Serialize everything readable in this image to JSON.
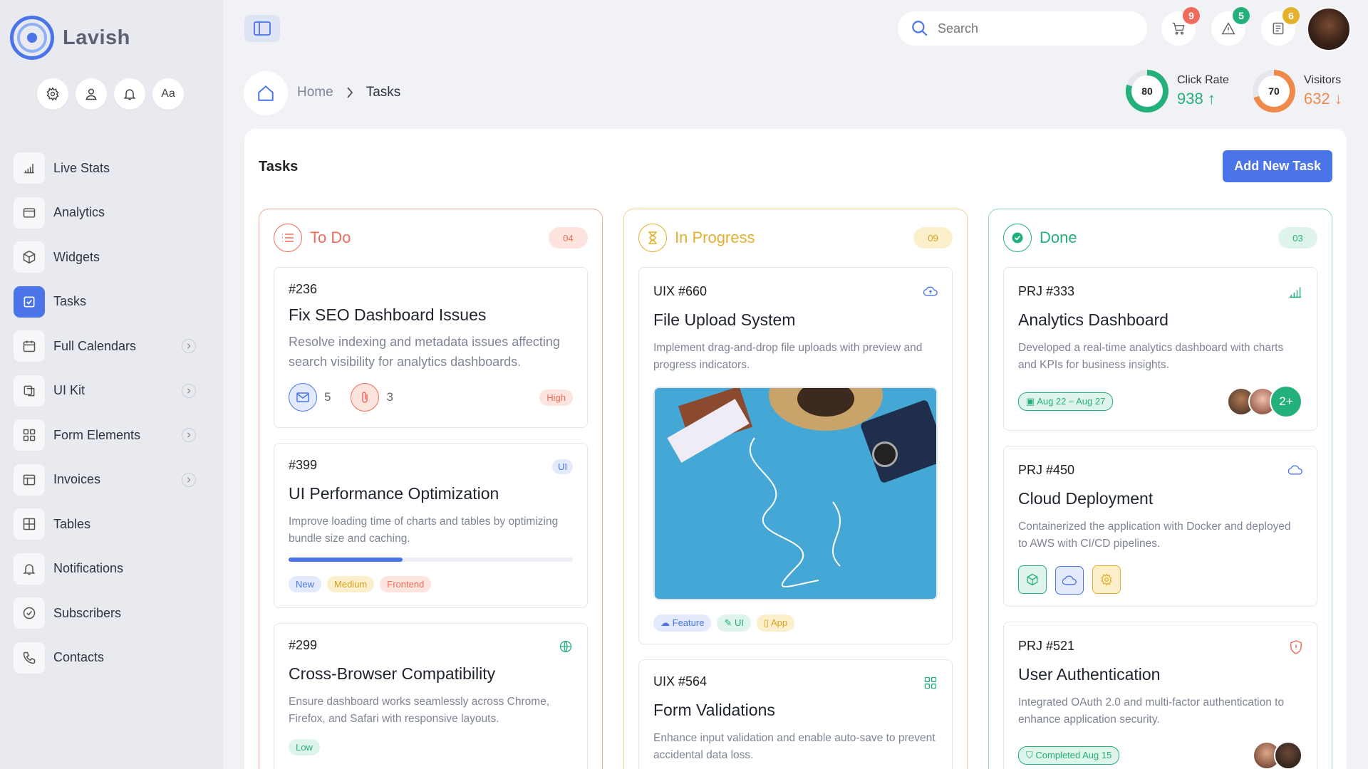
{
  "brand": {
    "name": "Lavish",
    "accent": "#4a74e8"
  },
  "quick_actions": [
    {
      "icon": "gear-icon"
    },
    {
      "icon": "user-icon"
    },
    {
      "icon": "bell-icon"
    },
    {
      "label": "Aa"
    }
  ],
  "nav": [
    {
      "label": "Live Stats",
      "icon": "bar-chart-icon"
    },
    {
      "label": "Analytics",
      "icon": "window-icon"
    },
    {
      "label": "Widgets",
      "icon": "cube-icon"
    },
    {
      "label": "Tasks",
      "icon": "checkbox-icon",
      "active": true
    },
    {
      "label": "Full Calendars",
      "icon": "calendar-icon",
      "has_chevron": true
    },
    {
      "label": "UI Kit",
      "icon": "layers-icon",
      "has_chevron": true
    },
    {
      "label": "Form Elements",
      "icon": "grid-icon",
      "has_chevron": true
    },
    {
      "label": "Invoices",
      "icon": "invoice-icon",
      "has_chevron": true
    },
    {
      "label": "Tables",
      "icon": "table-icon"
    },
    {
      "label": "Notifications",
      "icon": "bell-icon"
    },
    {
      "label": "Subscribers",
      "icon": "check-circle-icon"
    },
    {
      "label": "Contacts",
      "icon": "phone-icon"
    }
  ],
  "search": {
    "placeholder": "Search"
  },
  "top_badges": {
    "cart": "9",
    "alerts": "5",
    "notes": "6"
  },
  "breadcrumb": {
    "home": "Home",
    "current": "Tasks"
  },
  "stats": {
    "click_rate": {
      "label": "Click Rate",
      "value": "938 ↑",
      "ring": "80",
      "percent": 80,
      "color": "#23b07a"
    },
    "visitors": {
      "label": "Visitors",
      "value": "632 ↓",
      "ring": "70",
      "percent": 70,
      "color": "#f08a4b"
    }
  },
  "panel": {
    "title": "Tasks",
    "add_button": "Add New Task"
  },
  "columns": {
    "todo": {
      "title": "To Do",
      "count": "04",
      "color": "#f06b5a"
    },
    "progress": {
      "title": "In Progress",
      "count": "09",
      "color": "#e5b02c"
    },
    "done": {
      "title": "Done",
      "count": "03",
      "color": "#23b07a"
    }
  },
  "todo_cards": [
    {
      "id": "#236",
      "title": "Fix SEO Dashboard Issues",
      "desc": "Resolve indexing and metadata issues affecting search visibility for analytics dashboards.",
      "mail_count": "5",
      "attach_count": "3",
      "priority": "High"
    },
    {
      "id": "#399",
      "title": "UI Performance Optimization",
      "desc": "Improve loading time of charts and tables by optimizing bundle size and caching.",
      "badge": "UI",
      "progress": 0.4,
      "tags": [
        "New",
        "Medium",
        "Frontend"
      ]
    },
    {
      "id": "#299",
      "title": "Cross-Browser Compatibility",
      "desc": "Ensure dashboard works seamlessly across Chrome, Firefox, and Safari with responsive layouts.",
      "tag": "Low"
    }
  ],
  "progress_cards": [
    {
      "id": "UIX #660",
      "title": "File Upload System",
      "desc": "Implement drag-and-drop file uploads with preview and progress indicators.",
      "tags": [
        "Feature",
        "UI",
        "App"
      ]
    },
    {
      "id": "UIX #564",
      "title": "Form Validations",
      "desc": "Enhance input validation and enable auto-save to prevent accidental data loss."
    }
  ],
  "done_cards": [
    {
      "id": "PRJ #333",
      "title": "Analytics Dashboard",
      "desc": "Developed a real-time analytics dashboard with charts and KPIs for business insights.",
      "date": "Aug 22 – Aug 27",
      "more": "2+"
    },
    {
      "id": "PRJ #450",
      "title": "Cloud Deployment",
      "desc": "Containerized the application with Docker and deployed to AWS with CI/CD pipelines."
    },
    {
      "id": "PRJ #521",
      "title": "User Authentication",
      "desc": "Integrated OAuth 2.0 and multi-factor authentication to enhance application security.",
      "status": "Completed Aug 15"
    }
  ]
}
